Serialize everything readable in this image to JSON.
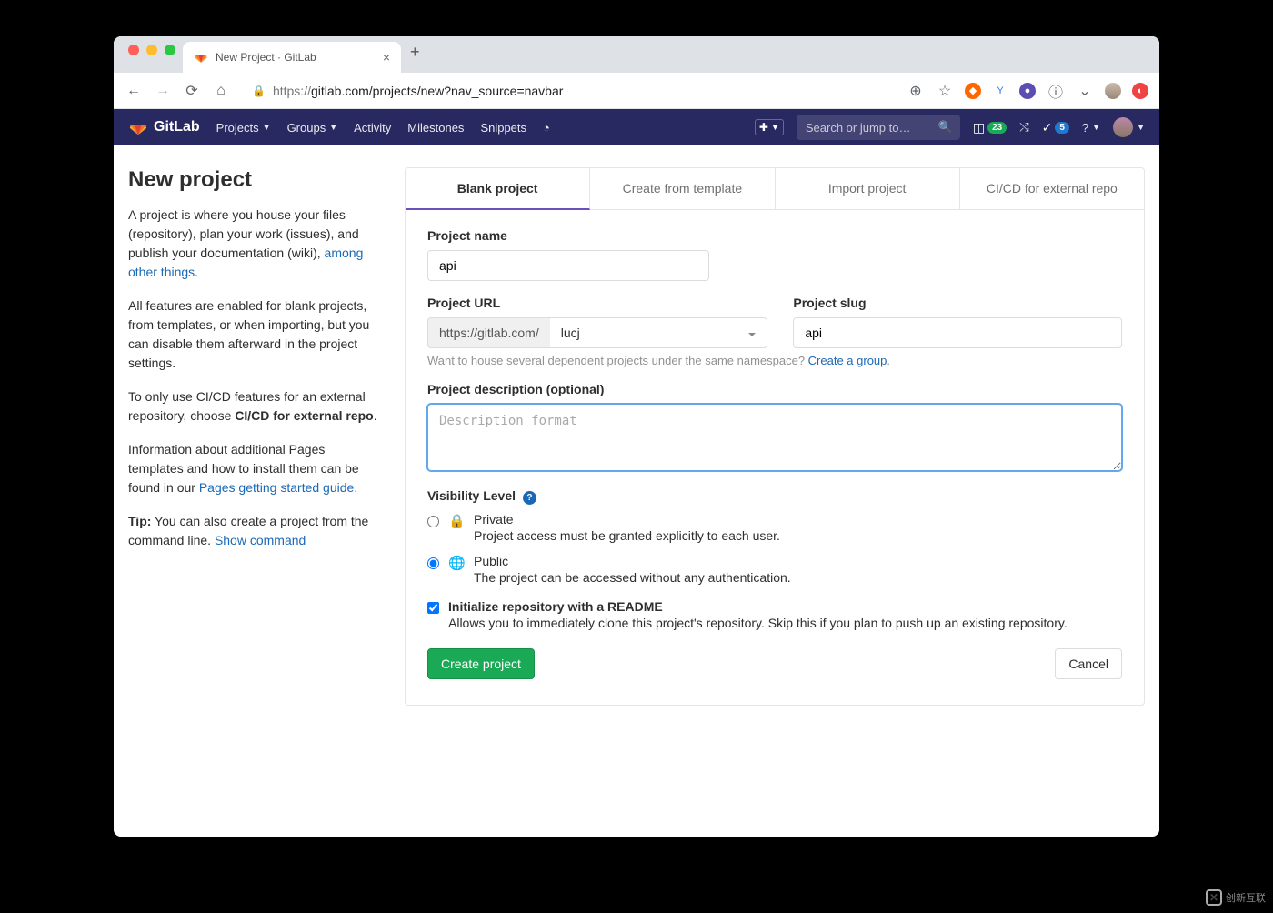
{
  "browser": {
    "tab_title": "New Project · GitLab",
    "url_prefix": "https://",
    "url_rest": "gitlab.com/projects/new?nav_source=navbar"
  },
  "nav": {
    "brand": "GitLab",
    "items": [
      "Projects",
      "Groups",
      "Activity",
      "Milestones",
      "Snippets"
    ],
    "search_placeholder": "Search or jump to…",
    "issues_count": "23",
    "todos_count": "5"
  },
  "sidebar": {
    "title": "New project",
    "p1_a": "A project is where you house your files (repository), plan your work (issues), and publish your documentation (wiki), ",
    "p1_link": "among other things",
    "p2": "All features are enabled for blank projects, from templates, or when importing, but you can disable them afterward in the project settings.",
    "p3_a": "To only use CI/CD features for an external repository, choose ",
    "p3_b": "CI/CD for external repo",
    "p4_a": "Information about additional Pages templates and how to install them can be found in our ",
    "p4_link": "Pages getting started guide",
    "p5_tip": "Tip:",
    "p5_a": " You can also create a project from the command line. ",
    "p5_link": "Show command"
  },
  "tabs": [
    "Blank project",
    "Create from template",
    "Import project",
    "CI/CD for external repo"
  ],
  "form": {
    "name_label": "Project name",
    "name_value": "api",
    "url_label": "Project URL",
    "url_prefix": "https://gitlab.com/",
    "namespace": "lucj",
    "slug_label": "Project slug",
    "slug_value": "api",
    "ns_hint_a": "Want to house several dependent projects under the same namespace? ",
    "ns_hint_link": "Create a group",
    "desc_label": "Project description (optional)",
    "desc_placeholder": "Description format",
    "vis_label": "Visibility Level",
    "private_t": "Private",
    "private_d": "Project access must be granted explicitly to each user.",
    "public_t": "Public",
    "public_d": "The project can be accessed without any authentication.",
    "readme_t": "Initialize repository with a README",
    "readme_d": "Allows you to immediately clone this project's repository. Skip this if you plan to push up an existing repository.",
    "submit": "Create project",
    "cancel": "Cancel"
  },
  "watermark": "创新互联"
}
